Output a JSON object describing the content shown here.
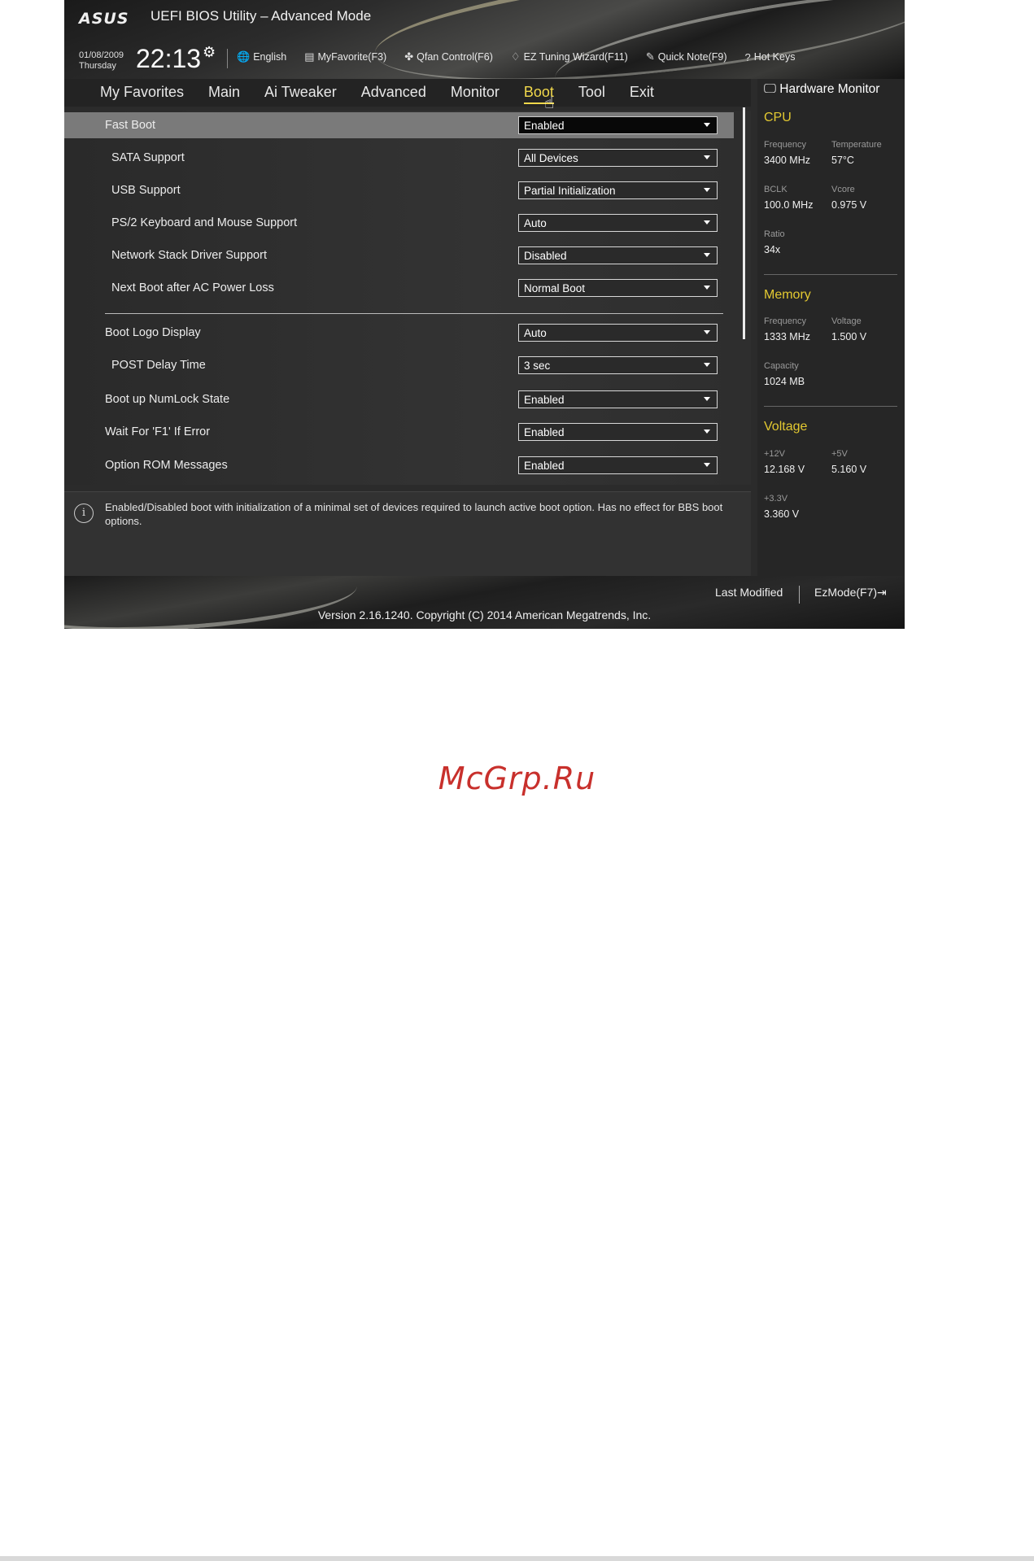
{
  "header": {
    "brand": "ASUS",
    "title": "UEFI BIOS Utility – Advanced Mode",
    "date": "01/08/2009",
    "day": "Thursday",
    "time": "22:13",
    "tools": [
      {
        "icon": "globe-icon",
        "glyph": "🌐",
        "label": "English"
      },
      {
        "icon": "favorite-icon",
        "glyph": "▤",
        "label": "MyFavorite(F3)"
      },
      {
        "icon": "fan-icon",
        "glyph": "✤",
        "label": "Qfan Control(F6)"
      },
      {
        "icon": "lightbulb-icon",
        "glyph": "♢",
        "label": "EZ Tuning Wizard(F11)"
      },
      {
        "icon": "note-icon",
        "glyph": "✎",
        "label": "Quick Note(F9)"
      },
      {
        "icon": "help-icon",
        "glyph": "?",
        "label": "Hot Keys"
      }
    ]
  },
  "menu": {
    "tabs": [
      "My Favorites",
      "Main",
      "Ai Tweaker",
      "Advanced",
      "Monitor",
      "Boot",
      "Tool",
      "Exit"
    ],
    "active": "Boot"
  },
  "settings": [
    {
      "label": "Fast Boot",
      "value": "Enabled",
      "highlight": true
    },
    {
      "label": "SATA Support",
      "value": "All Devices"
    },
    {
      "label": "USB Support",
      "value": "Partial Initialization"
    },
    {
      "label": "PS/2 Keyboard and Mouse Support",
      "value": "Auto"
    },
    {
      "label": "Network Stack Driver Support",
      "value": "Disabled"
    },
    {
      "label": "Next Boot after AC Power Loss",
      "value": "Normal Boot"
    },
    {
      "label": "Boot Logo Display",
      "value": "Auto"
    },
    {
      "label": "POST Delay Time",
      "value": "3 sec"
    },
    {
      "label": "Boot up NumLock State",
      "value": "Enabled"
    },
    {
      "label": "Wait For 'F1' If Error",
      "value": "Enabled"
    },
    {
      "label": "Option ROM Messages",
      "value": "Enabled"
    }
  ],
  "help": {
    "text": "Enabled/Disabled boot with initialization of a minimal set of devices required to launch active boot option. Has no effect for BBS boot options."
  },
  "hardware_monitor": {
    "title": "Hardware Monitor",
    "cpu": {
      "section": "CPU",
      "frequency_label": "Frequency",
      "frequency": "3400 MHz",
      "temperature_label": "Temperature",
      "temperature": "57°C",
      "bclk_label": "BCLK",
      "bclk": "100.0 MHz",
      "vcore_label": "Vcore",
      "vcore": "0.975 V",
      "ratio_label": "Ratio",
      "ratio": "34x"
    },
    "memory": {
      "section": "Memory",
      "frequency_label": "Frequency",
      "frequency": "1333 MHz",
      "voltage_label": "Voltage",
      "voltage": "1.500 V",
      "capacity_label": "Capacity",
      "capacity": "1024 MB"
    },
    "voltage": {
      "section": "Voltage",
      "v12_label": "+12V",
      "v12": "12.168 V",
      "v5_label": "+5V",
      "v5": "5.160 V",
      "v33_label": "+3.3V",
      "v33": "3.360 V"
    }
  },
  "footer": {
    "last_modified": "Last Modified",
    "ezmode": "EzMode(F7)",
    "ezmode_glyph": "⇥",
    "version": "Version 2.16.1240. Copyright (C) 2014 American Megatrends, Inc."
  },
  "watermark": "McGrp.Ru",
  "colors": {
    "accent_yellow": "#f1d84b",
    "section_yellow": "#e3c931",
    "highlight_row": "#7a7a7a",
    "watermark_red": "#c8302c"
  }
}
